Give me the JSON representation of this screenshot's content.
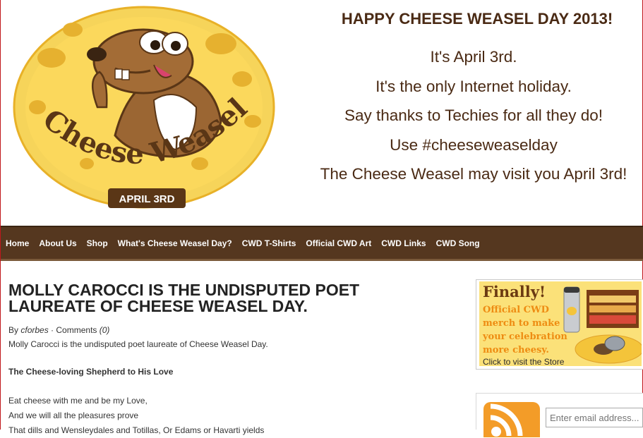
{
  "header": {
    "headline": "HAPPY CHEESE WEASEL DAY 2013!",
    "tagline": [
      "It's April 3rd.",
      "It's the only Internet holiday.",
      "Say thanks to Techies for all they do!",
      "Use #cheeseweaselday",
      "The Cheese Weasel may visit you April 3rd!"
    ],
    "logo": {
      "title": "Cheese Weasel Day",
      "date": "APRIL 3RD"
    }
  },
  "nav": {
    "items": [
      "Home",
      "About Us",
      "Shop",
      "What's Cheese Weasel Day?",
      "CWD T-Shirts",
      "Official CWD Art",
      "CWD Links",
      "CWD Song"
    ]
  },
  "article": {
    "title": "MOLLY CAROCCI IS THE UNDISPUTED POET LAUREATE OF CHEESE WEASEL DAY.",
    "by_label": "By",
    "author": "cforbes",
    "separator": " · ",
    "comments_label": "Comments",
    "comments_count": "(0)",
    "intro": "Molly Carocci is the undisputed poet laureate of  Cheese Weasel Day.",
    "poem_title": "The Cheese-loving Shepherd to His Love",
    "poem_lines": [
      "Eat cheese with me and be my Love,",
      "And we will all the pleasures prove",
      "That dills and Wensleydales and Totillas, Or Edams or Havarti yields"
    ]
  },
  "sidebar": {
    "ad": {
      "title": "Finally!",
      "lines": [
        "Official CWD",
        "merch to make",
        "your celebration",
        "more cheesy."
      ],
      "link": "Click to visit the Store"
    },
    "subscribe": {
      "email_placeholder": "Enter email address..."
    }
  },
  "colors": {
    "nav_bg": "#55371f",
    "heading": "#4a2a14",
    "cheese": "#f7c53c",
    "border_red": "#c0171c"
  }
}
